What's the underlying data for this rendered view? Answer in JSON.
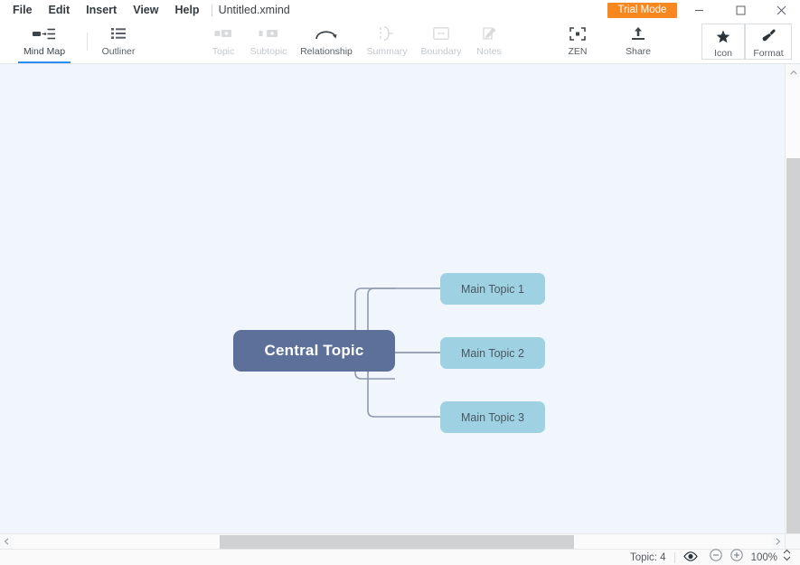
{
  "window": {
    "file_title": "Untitled.xmind",
    "trial_badge": "Trial Mode",
    "minimize": "minimize-icon",
    "maximize": "maximize-icon",
    "close": "close-icon"
  },
  "menubar": {
    "items": [
      {
        "label": "File"
      },
      {
        "label": "Edit"
      },
      {
        "label": "Insert"
      },
      {
        "label": "View"
      },
      {
        "label": "Help"
      }
    ]
  },
  "toolbar": {
    "left": [
      {
        "label": "Mind Map",
        "icon": "mindmap-icon",
        "state": "active"
      },
      {
        "label": "Outliner",
        "icon": "outliner-icon",
        "state": "enabled"
      }
    ],
    "middle": [
      {
        "label": "Topic",
        "icon": "topic-icon",
        "state": "disabled"
      },
      {
        "label": "Subtopic",
        "icon": "subtopic-icon",
        "state": "disabled"
      },
      {
        "label": "Relationship",
        "icon": "relationship-icon",
        "state": "enabled"
      },
      {
        "label": "Summary",
        "icon": "summary-icon",
        "state": "disabled"
      },
      {
        "label": "Boundary",
        "icon": "boundary-icon",
        "state": "disabled"
      },
      {
        "label": "Notes",
        "icon": "notes-icon",
        "state": "disabled"
      }
    ],
    "right": [
      {
        "label": "ZEN",
        "icon": "zen-icon",
        "state": "enabled"
      },
      {
        "label": "Share",
        "icon": "share-icon",
        "state": "enabled"
      }
    ],
    "boxed": [
      {
        "label": "Icon",
        "icon": "star-icon",
        "state": "enabled"
      },
      {
        "label": "Format",
        "icon": "brush-icon",
        "state": "enabled"
      }
    ]
  },
  "mindmap": {
    "central": {
      "label": "Central Topic",
      "color": "#5c7099",
      "text_color": "#ffffff"
    },
    "branches": [
      {
        "label": "Main Topic 1",
        "color": "#9ed2e3"
      },
      {
        "label": "Main Topic 2",
        "color": "#9ed2e3"
      },
      {
        "label": "Main Topic 3",
        "color": "#9ed2e3"
      }
    ],
    "canvas_color": "#f1f6fc",
    "connector_color": "#8e9aab"
  },
  "statusbar": {
    "topic_count": "Topic: 4",
    "eye_icon": "eye-icon",
    "zoom_out": "minus-icon",
    "zoom_in": "plus-icon",
    "zoom_level": "100%",
    "zoom_stepper": "chevron-updown-icon"
  },
  "scrollbars": {
    "vertical_up": "chevron-up-icon",
    "horizontal_left": "chevron-left-icon",
    "horizontal_right": "chevron-right-icon"
  }
}
